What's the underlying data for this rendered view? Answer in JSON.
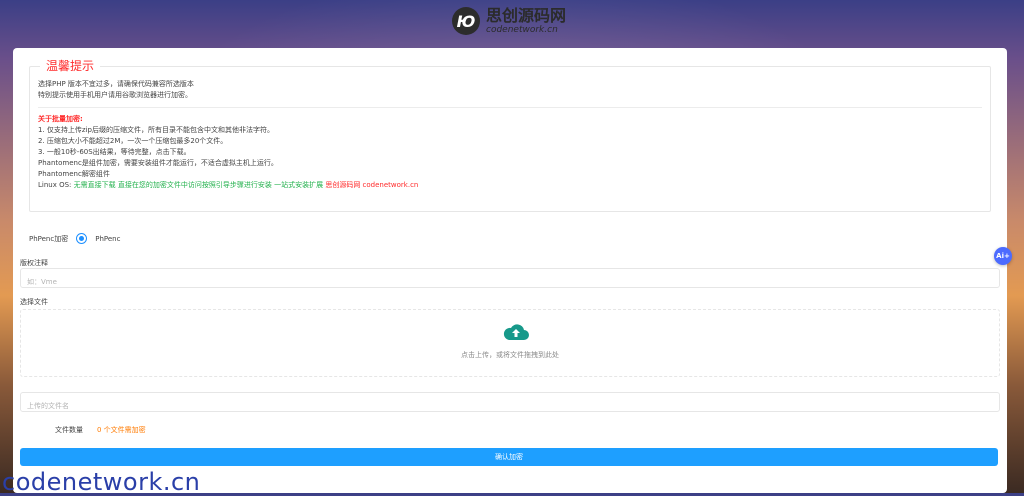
{
  "header": {
    "logo_mark": "Ю",
    "logo_cn": "思创源码网",
    "logo_en": "codenetwork.cn"
  },
  "tips": {
    "legend": "温馨提示",
    "line1": "选择PHP 版本不宜过多，请确保代码兼容所选版本",
    "line2": "特别提示使用手机用户请用谷歌浏览器进行加密。",
    "batch_title": "关于批量加密:",
    "batch_items": [
      "1. 仅支持上传zip后缀的压缩文件，所有目录不能包含中文和其他非法字符。",
      "2. 压缩包大小不能超过2M，一次一个压缩包最多20个文件。",
      "3. 一般10秒-60S出结果，等待完整，点击下载。",
      "Phantomenc是组件加密，需要安装组件才能运行，不适合虚拟主机上运行。",
      "Phantomenc解密组件"
    ],
    "linux_prefix": "Linux OS:",
    "linux_green": "无需直接下载 直接在您的加密文件中访问按照引导步骤进行安装 一站式安装扩展",
    "linux_red": "思创源码网 codenetwork.cn"
  },
  "form": {
    "encrypt_label": "PhPenc加密",
    "encrypt_option": "PhPenc",
    "copyright_label": "版权注释",
    "copyright_placeholder": "如：Vme",
    "file_label": "选择文件",
    "upload_hint": "点击上传，或将文件拖拽到此处",
    "filename_placeholder": "上传的文件名",
    "count_label": "文件数量",
    "count_value": "0 个文件需加密",
    "submit": "确认加密"
  },
  "ai_badge": "Ai+",
  "watermark": "codenetwork.cn"
}
